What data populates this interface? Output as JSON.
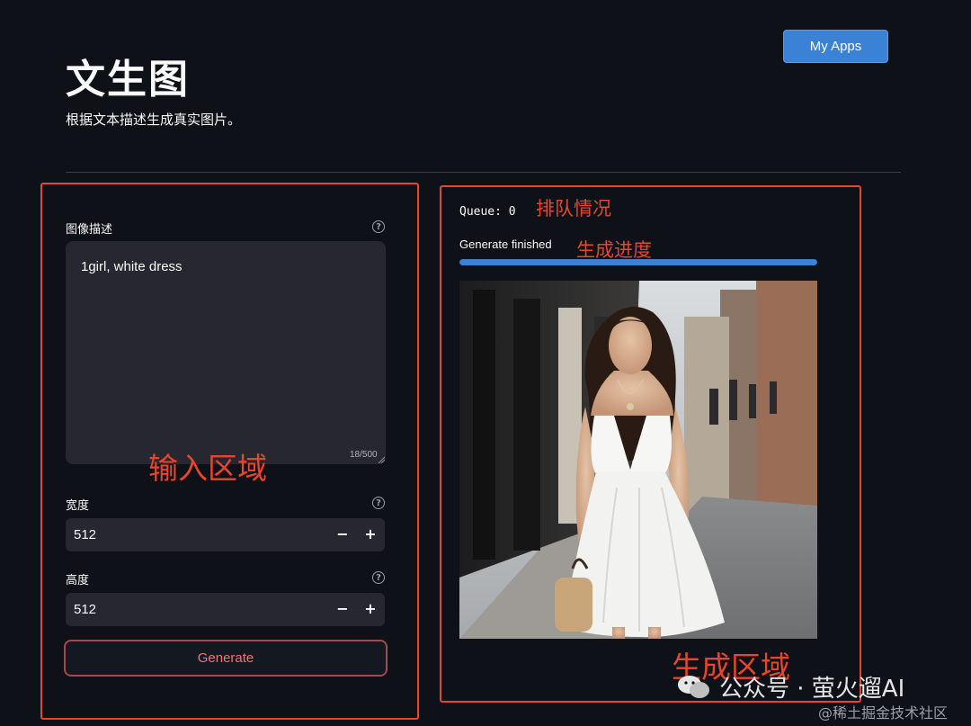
{
  "header": {
    "title": "文生图",
    "subtitle": "根据文本描述生成真实图片。",
    "my_apps_label": "My Apps"
  },
  "input_panel": {
    "prompt_label": "图像描述",
    "prompt_value": "1girl, white dress",
    "char_counter": "18/500",
    "width_label": "宽度",
    "width_value": "512",
    "height_label": "高度",
    "height_value": "512",
    "minus": "−",
    "plus": "+",
    "help": "?",
    "generate_label": "Generate"
  },
  "output_panel": {
    "queue_text": "Queue: 0",
    "status_text": "Generate finished",
    "progress": 1.0
  },
  "annotations": {
    "input_area": "输入区域",
    "queue_status": "排队情况",
    "progress": "生成进度",
    "output_area": "生成区域"
  },
  "watermark": {
    "account": "公众号 · 萤火遛AI",
    "site": "@稀土掘金技术社区"
  },
  "colors": {
    "background": "#0e1117",
    "accent": "#3b82d6",
    "annotation_red": "#e5462f",
    "input_bg": "#262730"
  }
}
